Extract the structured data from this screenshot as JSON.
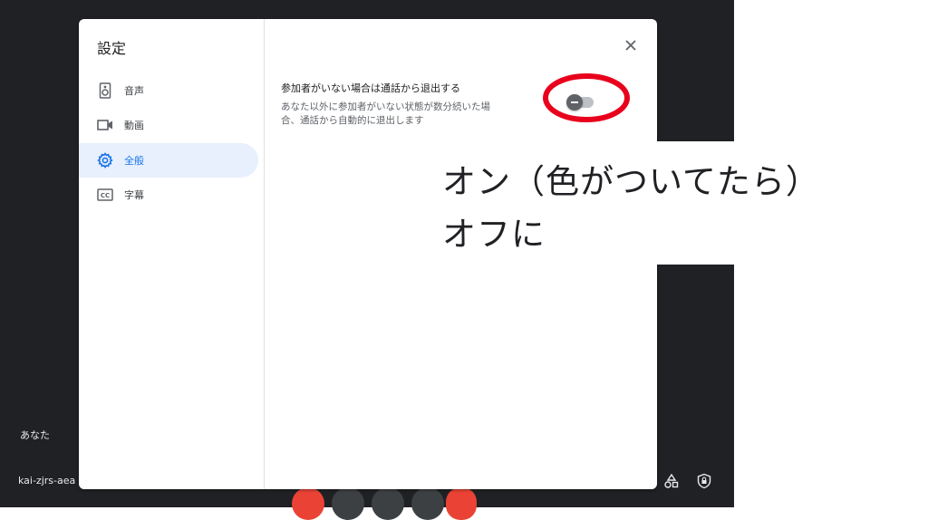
{
  "meeting": {
    "you_label": "あなた",
    "meeting_code": "kai-zjrs-aea"
  },
  "dialog": {
    "title": "設定",
    "close_icon": "close-icon",
    "nav": [
      {
        "label": "音声",
        "icon": "speaker-icon",
        "active": false
      },
      {
        "label": "動画",
        "icon": "videocam-icon",
        "active": false
      },
      {
        "label": "全般",
        "icon": "gear-icon",
        "active": true
      },
      {
        "label": "字幕",
        "icon": "captions-icon",
        "active": false
      }
    ],
    "setting": {
      "title": "参加者がいない場合は通話から退出する",
      "description": "あなた以外に参加者がいない状態が数分続いた場合、通話から自動的に退出します",
      "toggle_state": "off"
    }
  },
  "annotation": {
    "line1": "オン（色がついてたら）",
    "line2": "オフに",
    "ellipse_color": "#e8001c"
  },
  "colors": {
    "accent": "#1a73e8",
    "active_bg": "#e8f0fe",
    "meet_bg": "#202124",
    "end_call": "#ea4335"
  }
}
